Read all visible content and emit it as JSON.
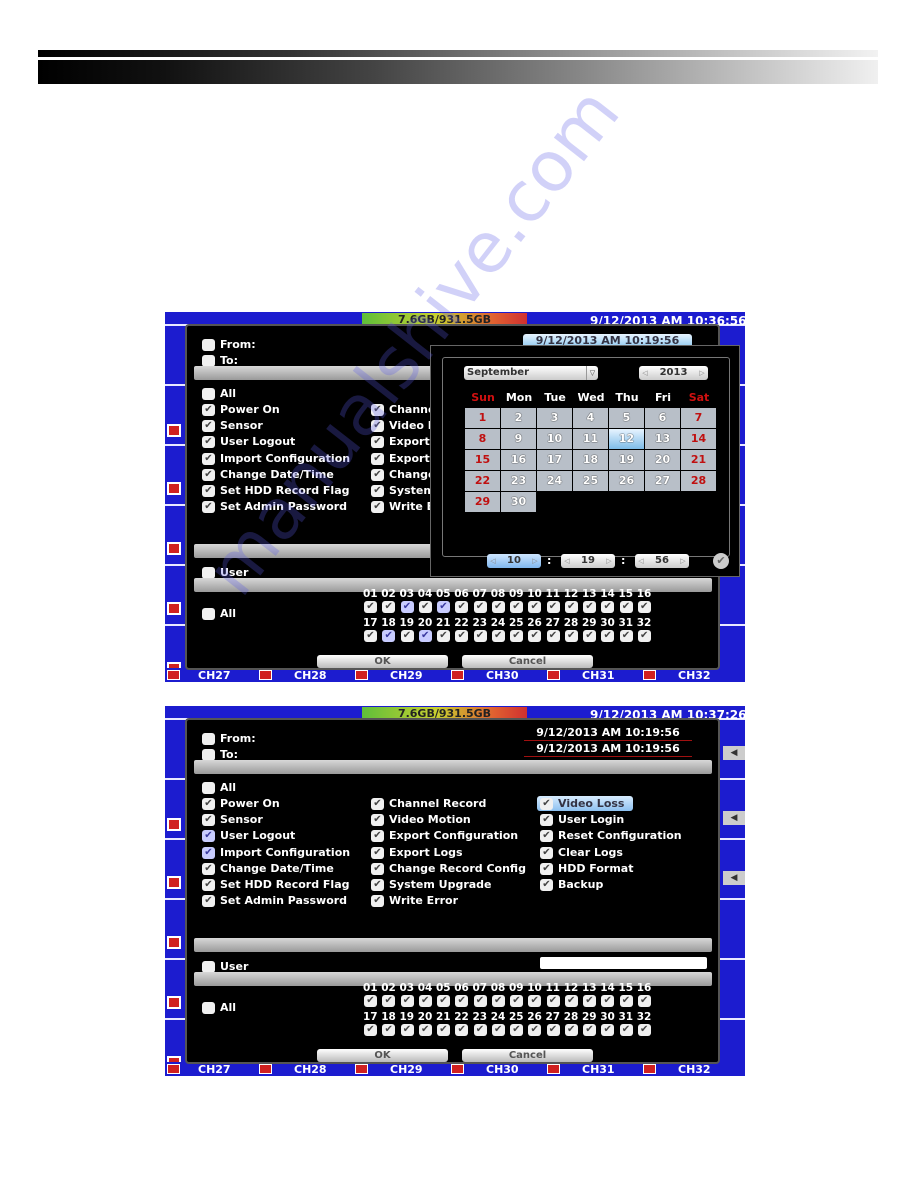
{
  "watermark": "manualshive.com",
  "colors": {
    "screen_bg": "#1c1ccf",
    "dialog_bg": "#000000",
    "weekend": "#d01010",
    "selected": "#7fbce8"
  },
  "screens": [
    {
      "clock": "9/12/2013 AM 10:36:56",
      "hdd": "7.6GB/931.5GB",
      "from_label": "From:",
      "to_label": "To:",
      "date_value": "9/12/2013 AM 10:19:56",
      "all_label": "All",
      "events": [
        [
          {
            "label": "Power On",
            "checked": true
          },
          {
            "label": "Sensor",
            "checked": true
          },
          {
            "label": "User Logout",
            "checked": true
          },
          {
            "label": "Import Configuration",
            "checked": true
          },
          {
            "label": "Change Date/Time",
            "checked": true
          },
          {
            "label": "Set HDD Record Flag",
            "checked": true
          },
          {
            "label": "Set Admin Password",
            "checked": true
          }
        ],
        [
          {
            "label": "Channel Record",
            "checked": true
          },
          {
            "label": "Video Motion",
            "checked": true
          },
          {
            "label": "Export Configuration",
            "checked": true
          },
          {
            "label": "Export Logs",
            "checked": true
          },
          {
            "label": "Change Record Config",
            "checked": true
          },
          {
            "label": "System Upgrade",
            "checked": true
          },
          {
            "label": "Write Error",
            "checked": true
          }
        ]
      ],
      "user_label": "User",
      "channel_all_label": "All",
      "channels": [
        "01",
        "02",
        "03",
        "04",
        "05",
        "06",
        "07",
        "08",
        "09",
        "10",
        "11",
        "12",
        "13",
        "14",
        "15",
        "16",
        "17",
        "18",
        "19",
        "20",
        "21",
        "22",
        "23",
        "24",
        "25",
        "26",
        "27",
        "28",
        "29",
        "30",
        "31",
        "32"
      ],
      "ok_label": "OK",
      "cancel_label": "Cancel",
      "bottom_channels": [
        "CH27",
        "CH28",
        "CH29",
        "CH30",
        "CH31",
        "CH32"
      ],
      "calendar": {
        "month": "September",
        "year": "2013",
        "weekdays": [
          "Sun",
          "Mon",
          "Tue",
          "Wed",
          "Thu",
          "Fri",
          "Sat"
        ],
        "days": [
          "1",
          "2",
          "3",
          "4",
          "5",
          "6",
          "7",
          "8",
          "9",
          "10",
          "11",
          "12",
          "13",
          "14",
          "15",
          "16",
          "17",
          "18",
          "19",
          "20",
          "21",
          "22",
          "23",
          "24",
          "25",
          "26",
          "27",
          "28",
          "29",
          "30"
        ],
        "selected_day": 12,
        "hour": "10",
        "minute": "19",
        "second": "56",
        "separator": ":"
      }
    },
    {
      "clock": "9/12/2013 AM 10:37:26",
      "hdd": "7.6GB/931.5GB",
      "from_label": "From:",
      "to_label": "To:",
      "from_value": "9/12/2013 AM 10:19:56",
      "to_value": "9/12/2013 AM 10:19:56",
      "all_label": "All",
      "events": [
        [
          {
            "label": "Power On",
            "checked": true
          },
          {
            "label": "Sensor",
            "checked": true
          },
          {
            "label": "User Logout",
            "checked": true
          },
          {
            "label": "Import Configuration",
            "checked": true
          },
          {
            "label": "Change Date/Time",
            "checked": true
          },
          {
            "label": "Set HDD Record Flag",
            "checked": true
          },
          {
            "label": "Set Admin Password",
            "checked": true
          }
        ],
        [
          {
            "label": "Channel Record",
            "checked": true
          },
          {
            "label": "Video Motion",
            "checked": true
          },
          {
            "label": "Export Configuration",
            "checked": true
          },
          {
            "label": "Export Logs",
            "checked": true
          },
          {
            "label": "Change Record Config",
            "checked": true
          },
          {
            "label": "System Upgrade",
            "checked": true
          },
          {
            "label": "Write Error",
            "checked": true
          }
        ],
        [
          {
            "label": "Video Loss",
            "checked": true,
            "highlighted": true
          },
          {
            "label": "User Login",
            "checked": true
          },
          {
            "label": "Reset Configuration",
            "checked": true
          },
          {
            "label": "Clear Logs",
            "checked": true
          },
          {
            "label": "HDD Format",
            "checked": true
          },
          {
            "label": "Backup",
            "checked": true
          }
        ]
      ],
      "user_label": "User",
      "user_input_value": "",
      "channel_all_label": "All",
      "channels": [
        "01",
        "02",
        "03",
        "04",
        "05",
        "06",
        "07",
        "08",
        "09",
        "10",
        "11",
        "12",
        "13",
        "14",
        "15",
        "16",
        "17",
        "18",
        "19",
        "20",
        "21",
        "22",
        "23",
        "24",
        "25",
        "26",
        "27",
        "28",
        "29",
        "30",
        "31",
        "32"
      ],
      "ok_label": "OK",
      "cancel_label": "Cancel",
      "bottom_channels": [
        "CH27",
        "CH28",
        "CH29",
        "CH30",
        "CH31",
        "CH32"
      ]
    }
  ]
}
